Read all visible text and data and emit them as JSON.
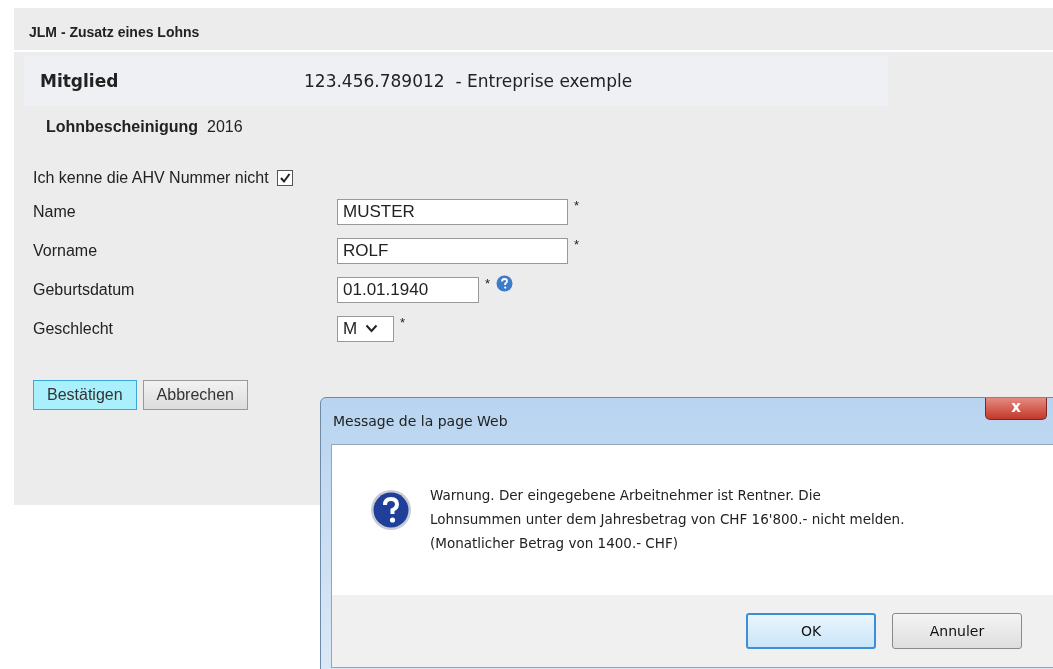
{
  "page": {
    "title": "JLM - Zusatz eines Lohns",
    "member": {
      "label": "Mitglied",
      "value": "123.456.789012  - Entreprise exemple"
    },
    "certificate": {
      "label": "Lohnbescheinigung",
      "value": "2016"
    },
    "ahv_unknown": {
      "label": "Ich kenne die AHV Nummer nicht",
      "checked": true
    },
    "fields": [
      {
        "kind": "text",
        "label": "Name",
        "value": "MUSTER",
        "required": "*"
      },
      {
        "kind": "text",
        "label": "Vorname",
        "value": "ROLF",
        "required": "*"
      },
      {
        "kind": "date",
        "label": "Geburtsdatum",
        "value": "01.01.1940",
        "required": "*"
      },
      {
        "kind": "select",
        "label": "Geschlecht",
        "value": "M",
        "required": "*"
      }
    ],
    "buttons": [
      {
        "label": "Bestätigen",
        "selected": true
      },
      {
        "label": "Abbrechen",
        "selected": false
      }
    ]
  },
  "dialog": {
    "title": "Message de la page Web",
    "close": "x",
    "message_lines": [
      "Warnung. Der eingegebene Arbeitnehmer ist Rentner. Die",
      "Lohnsummen unter dem Jahresbetrag von CHF 16'800.- nicht melden.",
      "(Monatlicher Betrag von 1400.- CHF)"
    ],
    "buttons": [
      {
        "label": "OK",
        "selected": true
      },
      {
        "label": "Annuler",
        "selected": false
      }
    ]
  }
}
